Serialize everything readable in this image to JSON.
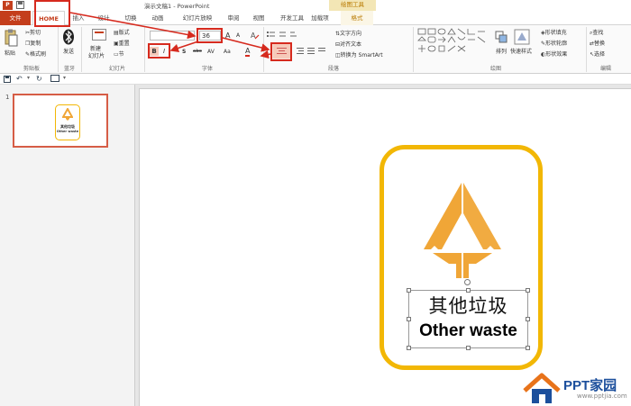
{
  "titlebar": {
    "app_icon": "P",
    "doc_title": "演示文稿1 - PowerPoint",
    "context_tool": "绘图工具"
  },
  "tabs": {
    "file": "文件",
    "home": "HOME",
    "insert": "插入",
    "design": "设计",
    "transition": "切换",
    "animation": "动画",
    "slideshow": "幻灯片放映",
    "review": "审阅",
    "view": "视图",
    "developer": "开发工具",
    "addins": "加载项",
    "format": "格式"
  },
  "ribbon": {
    "clipboard": {
      "paste": "粘贴",
      "cut": "剪切",
      "copy": "复制",
      "format_painter": "格式刷",
      "label": "剪贴板"
    },
    "bluetooth": {
      "send": "发送",
      "label": "蓝牙"
    },
    "slides": {
      "new_slide": "新建",
      "new_slide2": "幻灯片",
      "layout": "版式",
      "reset": "重置",
      "section": "节",
      "label": "幻灯片"
    },
    "font": {
      "size": "36",
      "grow": "A",
      "shrink": "A",
      "bold": "B",
      "italic": "I",
      "strike": "abc",
      "spacing": "AV",
      "case": "Aa",
      "color": "A",
      "label": "字体"
    },
    "paragraph": {
      "text_direction": "文字方向",
      "align_text": "对齐文本",
      "smartart": "转换为 SmartArt",
      "label": "段落"
    },
    "drawing": {
      "arrange": "排列",
      "quick_styles": "快速样式",
      "fill": "形状填充",
      "outline": "形状轮廓",
      "effects": "形状效果",
      "label": "绘图"
    },
    "editing": {
      "find": "查找",
      "replace": "替换",
      "select": "选择",
      "label": "编辑"
    }
  },
  "thumbnail": {
    "number": "1",
    "cn": "其他垃圾",
    "en": "Other waste"
  },
  "slide": {
    "title_cn": "其他垃圾",
    "title_en": "Other waste"
  },
  "watermark": {
    "brand": "PPT家园",
    "url": "www.pptjia.com"
  },
  "colors": {
    "accent": "#c43e1c",
    "sign_border": "#f2b705",
    "icon_orange": "#f0a637",
    "highlight_red": "#d62a1e"
  }
}
